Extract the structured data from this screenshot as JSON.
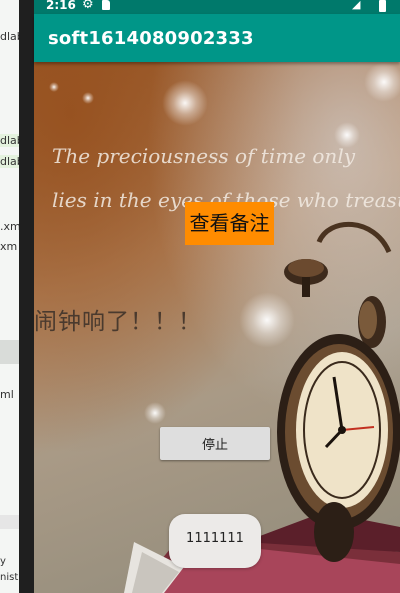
{
  "ide": {
    "fragments": [
      "dlab",
      "dlab",
      "dlab",
      ".xm",
      "xm",
      "ml",
      "y",
      "nisti"
    ]
  },
  "status_bar": {
    "time": "2:16",
    "icons": [
      "gear-icon",
      "sd-card-icon",
      "signal-icon",
      "battery-icon"
    ]
  },
  "app_bar": {
    "title": "soft1614080902333"
  },
  "background": {
    "quote_line_1": "The preciousness of time only",
    "quote_line_2": "lies in the eyes of those who treasure it."
  },
  "main": {
    "memo_button_label": "查看备注",
    "alarm_text": "闹钟响了！！！",
    "stop_button_label": "停止"
  },
  "toast": {
    "message": "1111111"
  },
  "colors": {
    "status_bar": "#00796b",
    "app_bar": "#009688",
    "memo_button": "#ff8c00",
    "stop_button": "#dedede"
  }
}
